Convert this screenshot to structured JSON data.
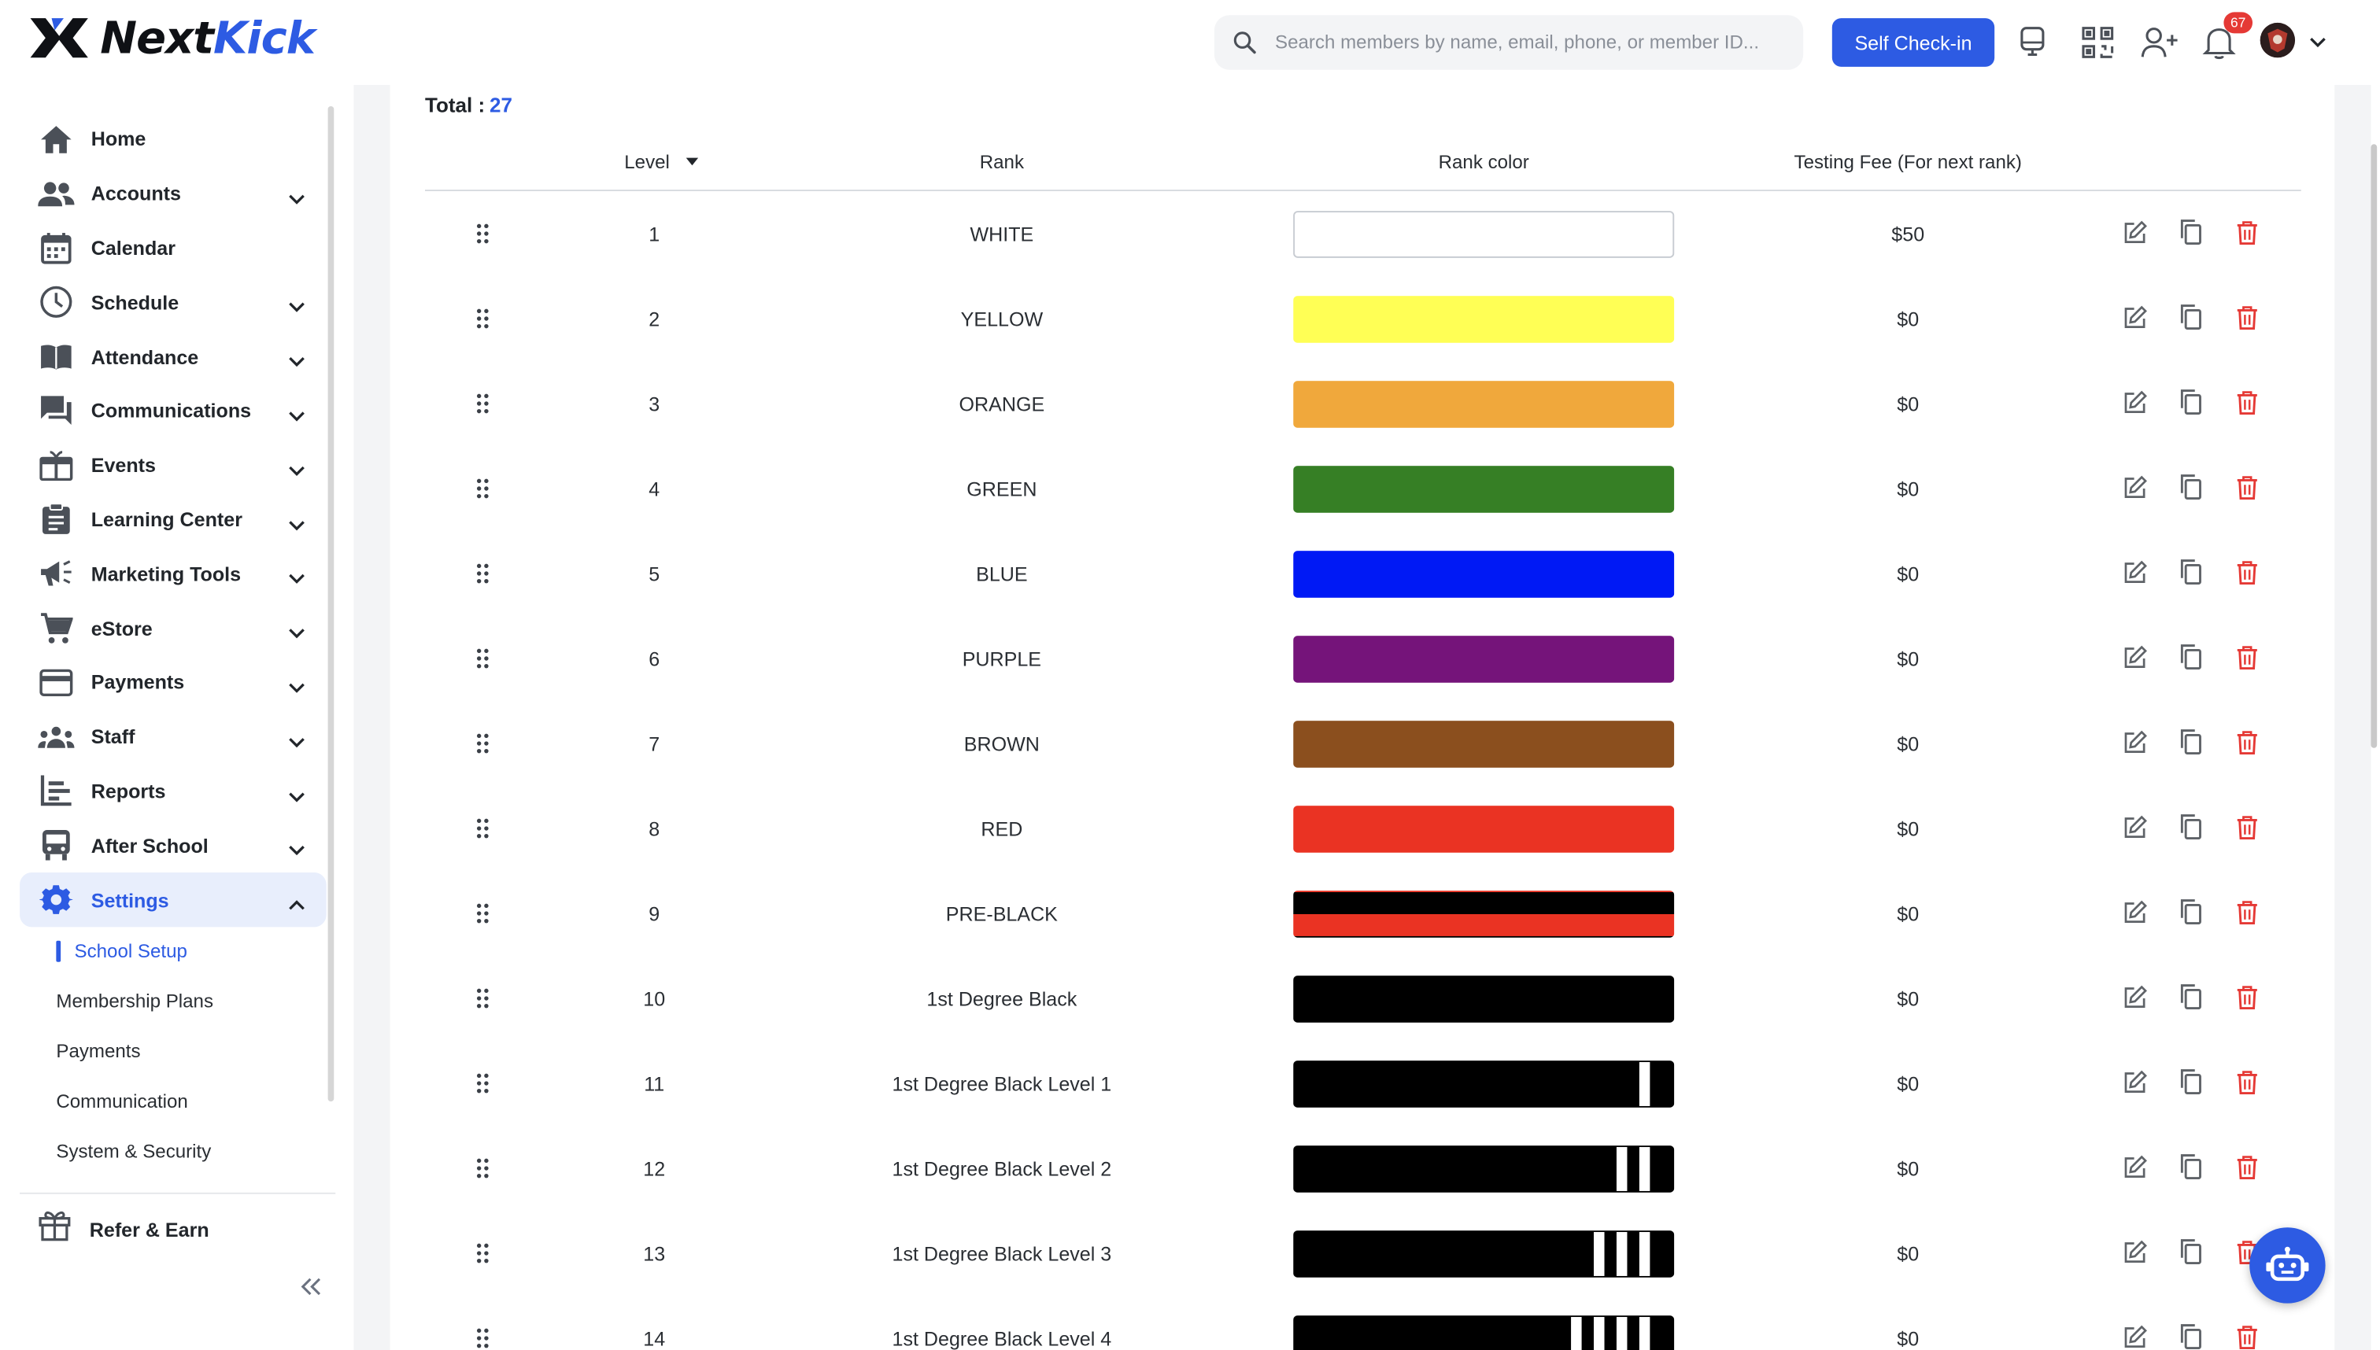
{
  "app": {
    "logo_part1": "Next",
    "logo_part2": "Kick"
  },
  "header": {
    "search_placeholder": "Search members by name, email, phone, or member ID...",
    "checkin_label": "Self Check-in",
    "notification_count": "67",
    "icons": [
      "kiosk-icon",
      "qr-code-icon",
      "add-user-icon",
      "bell-icon",
      "avatar",
      "chevron-down-icon"
    ]
  },
  "sidebar": {
    "items": [
      {
        "label": "Home",
        "icon": "home-icon",
        "expandable": false
      },
      {
        "label": "Accounts",
        "icon": "accounts-icon",
        "expandable": true
      },
      {
        "label": "Calendar",
        "icon": "calendar-icon",
        "expandable": false
      },
      {
        "label": "Schedule",
        "icon": "clock-icon",
        "expandable": true
      },
      {
        "label": "Attendance",
        "icon": "book-icon",
        "expandable": true
      },
      {
        "label": "Communications",
        "icon": "chat-icon",
        "expandable": true
      },
      {
        "label": "Events",
        "icon": "events-icon",
        "expandable": true
      },
      {
        "label": "Learning Center",
        "icon": "clipboard-icon",
        "expandable": true
      },
      {
        "label": "Marketing Tools",
        "icon": "megaphone-icon",
        "expandable": true
      },
      {
        "label": "eStore",
        "icon": "cart-icon",
        "expandable": true
      },
      {
        "label": "Payments",
        "icon": "card-icon",
        "expandable": true
      },
      {
        "label": "Staff",
        "icon": "staff-icon",
        "expandable": true
      },
      {
        "label": "Reports",
        "icon": "reports-icon",
        "expandable": true
      },
      {
        "label": "After School",
        "icon": "bus-icon",
        "expandable": true
      },
      {
        "label": "Settings",
        "icon": "gear-icon",
        "expandable": true,
        "active": true
      }
    ],
    "sub_items": [
      {
        "label": "School Setup",
        "active": true
      },
      {
        "label": "Membership Plans"
      },
      {
        "label": "Payments"
      },
      {
        "label": "Communication"
      },
      {
        "label": "System & Security"
      }
    ],
    "refer_label": "Refer & Earn"
  },
  "main": {
    "total_label": "Total :",
    "total_value": "27",
    "columns": {
      "level": "Level",
      "rank": "Rank",
      "rank_color": "Rank color",
      "fee": "Testing Fee (For next rank)"
    },
    "rows": [
      {
        "level": "1",
        "rank": "WHITE",
        "color": "#ffffff",
        "stripes": 0,
        "fee": "$50"
      },
      {
        "level": "2",
        "rank": "YELLOW",
        "color": "#ffff55",
        "stripes": 0,
        "fee": "$0"
      },
      {
        "level": "3",
        "rank": "ORANGE",
        "color": "#f0a83c",
        "stripes": 0,
        "fee": "$0"
      },
      {
        "level": "4",
        "rank": "GREEN",
        "color": "#367f25",
        "stripes": 0,
        "fee": "$0"
      },
      {
        "level": "5",
        "rank": "BLUE",
        "color": "#0019f5",
        "stripes": 0,
        "fee": "$0"
      },
      {
        "level": "6",
        "rank": "PURPLE",
        "color": "#75147a",
        "stripes": 0,
        "fee": "$0"
      },
      {
        "level": "7",
        "rank": "BROWN",
        "color": "#8b4f1e",
        "stripes": 0,
        "fee": "$0"
      },
      {
        "level": "8",
        "rank": "RED",
        "color": "#ea3323",
        "stripes": 0,
        "fee": "$0"
      },
      {
        "level": "9",
        "rank": "PRE-BLACK",
        "color": "#000000",
        "color2": "#ea3323",
        "stripes": 0,
        "fee": "$0"
      },
      {
        "level": "10",
        "rank": "1st Degree Black",
        "color": "#000000",
        "stripes": 0,
        "fee": "$0"
      },
      {
        "level": "11",
        "rank": "1st Degree Black Level 1",
        "color": "#000000",
        "stripes": 1,
        "fee": "$0"
      },
      {
        "level": "12",
        "rank": "1st Degree Black Level 2",
        "color": "#000000",
        "stripes": 2,
        "fee": "$0"
      },
      {
        "level": "13",
        "rank": "1st Degree Black Level 3",
        "color": "#000000",
        "stripes": 3,
        "fee": "$0"
      },
      {
        "level": "14",
        "rank": "1st Degree Black Level 4",
        "color": "#000000",
        "stripes": 4,
        "fee": "$0"
      }
    ]
  },
  "colors": {
    "accent": "#2d5be3",
    "delete": "#e53935",
    "active_bg": "#e8eefc"
  }
}
